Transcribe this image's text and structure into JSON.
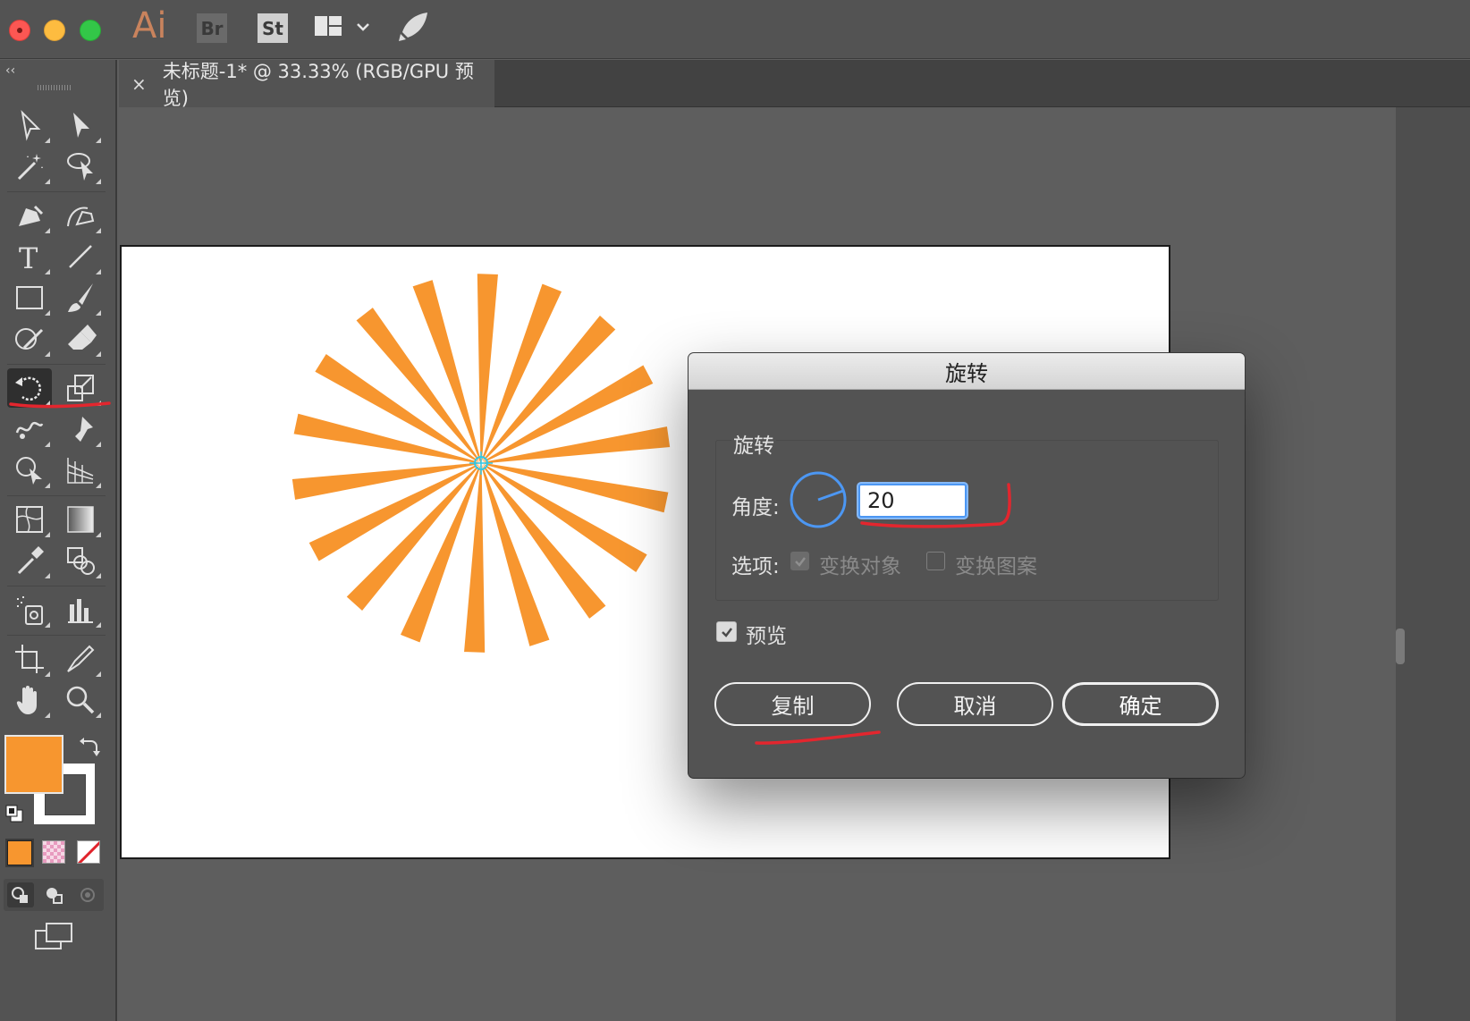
{
  "app": {
    "logo_text": "Ai",
    "bridge_label": "Br",
    "stock_label": "St"
  },
  "document_tab": {
    "close": "×",
    "title": "未标题-1* @ 33.33% (RGB/GPU 预览)"
  },
  "toolbar": {
    "collapse": "‹‹",
    "fill_color": "#f7962f",
    "stroke_color": "#ffffff"
  },
  "artwork": {
    "color": "#f7962f",
    "ray_count": 18
  },
  "rotate_dialog": {
    "title": "旋转",
    "group_label": "旋转",
    "angle_label": "角度:",
    "angle_value": "20",
    "options_label": "选项:",
    "transform_objects_label": "变换对象",
    "transform_objects_checked": true,
    "transform_patterns_label": "变换图案",
    "transform_patterns_checked": false,
    "preview_label": "预览",
    "preview_checked": true,
    "copy_button": "复制",
    "cancel_button": "取消",
    "ok_button": "确定"
  }
}
